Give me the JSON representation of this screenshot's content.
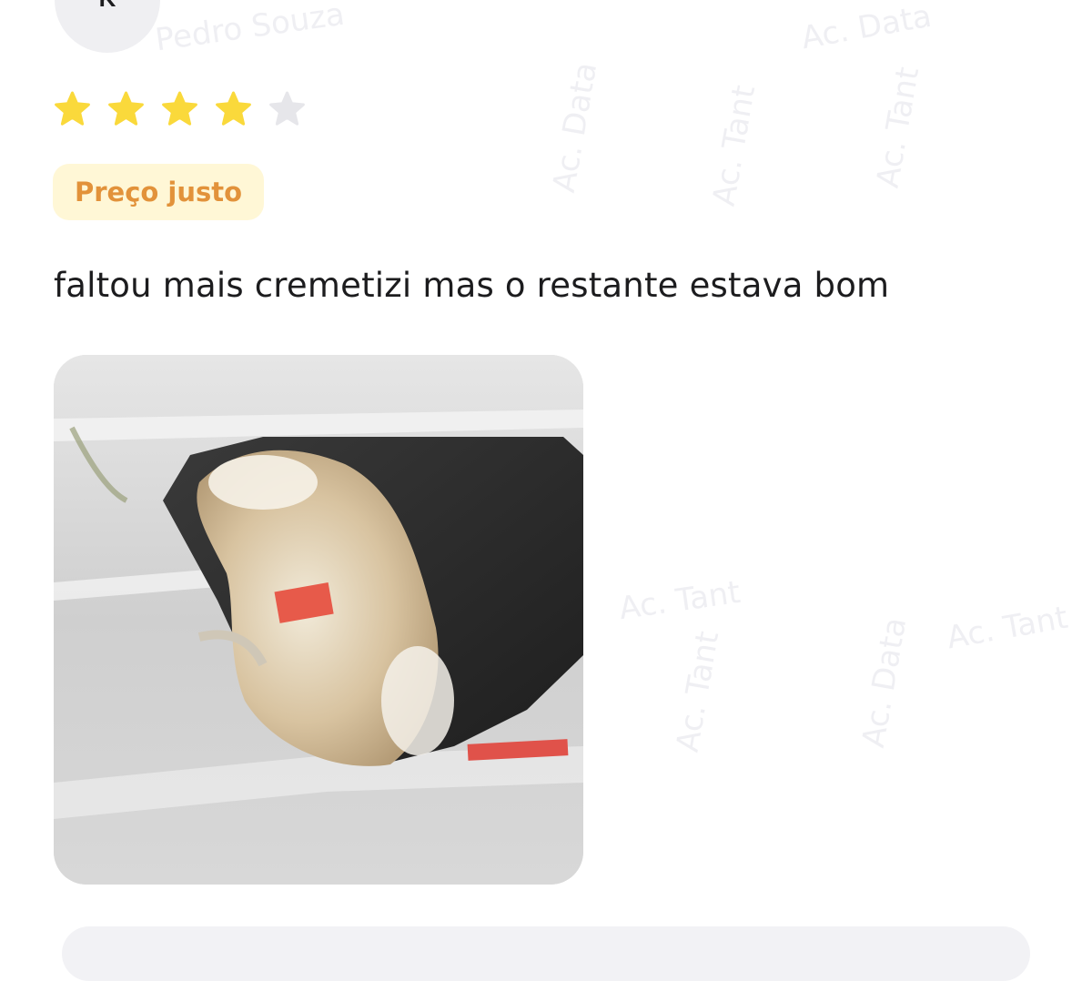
{
  "review": {
    "avatar_initial": "K",
    "rating": 4,
    "max_rating": 5,
    "tag_label": "Preço justo",
    "comment": "faltou mais cremetizi mas o restante estava bom"
  },
  "colors": {
    "star_filled": "#FAD93B",
    "star_empty": "#E6E6EA",
    "tag_bg": "#FFF7D6",
    "tag_text": "#E2923A"
  },
  "icons": {
    "star": "star-icon"
  }
}
